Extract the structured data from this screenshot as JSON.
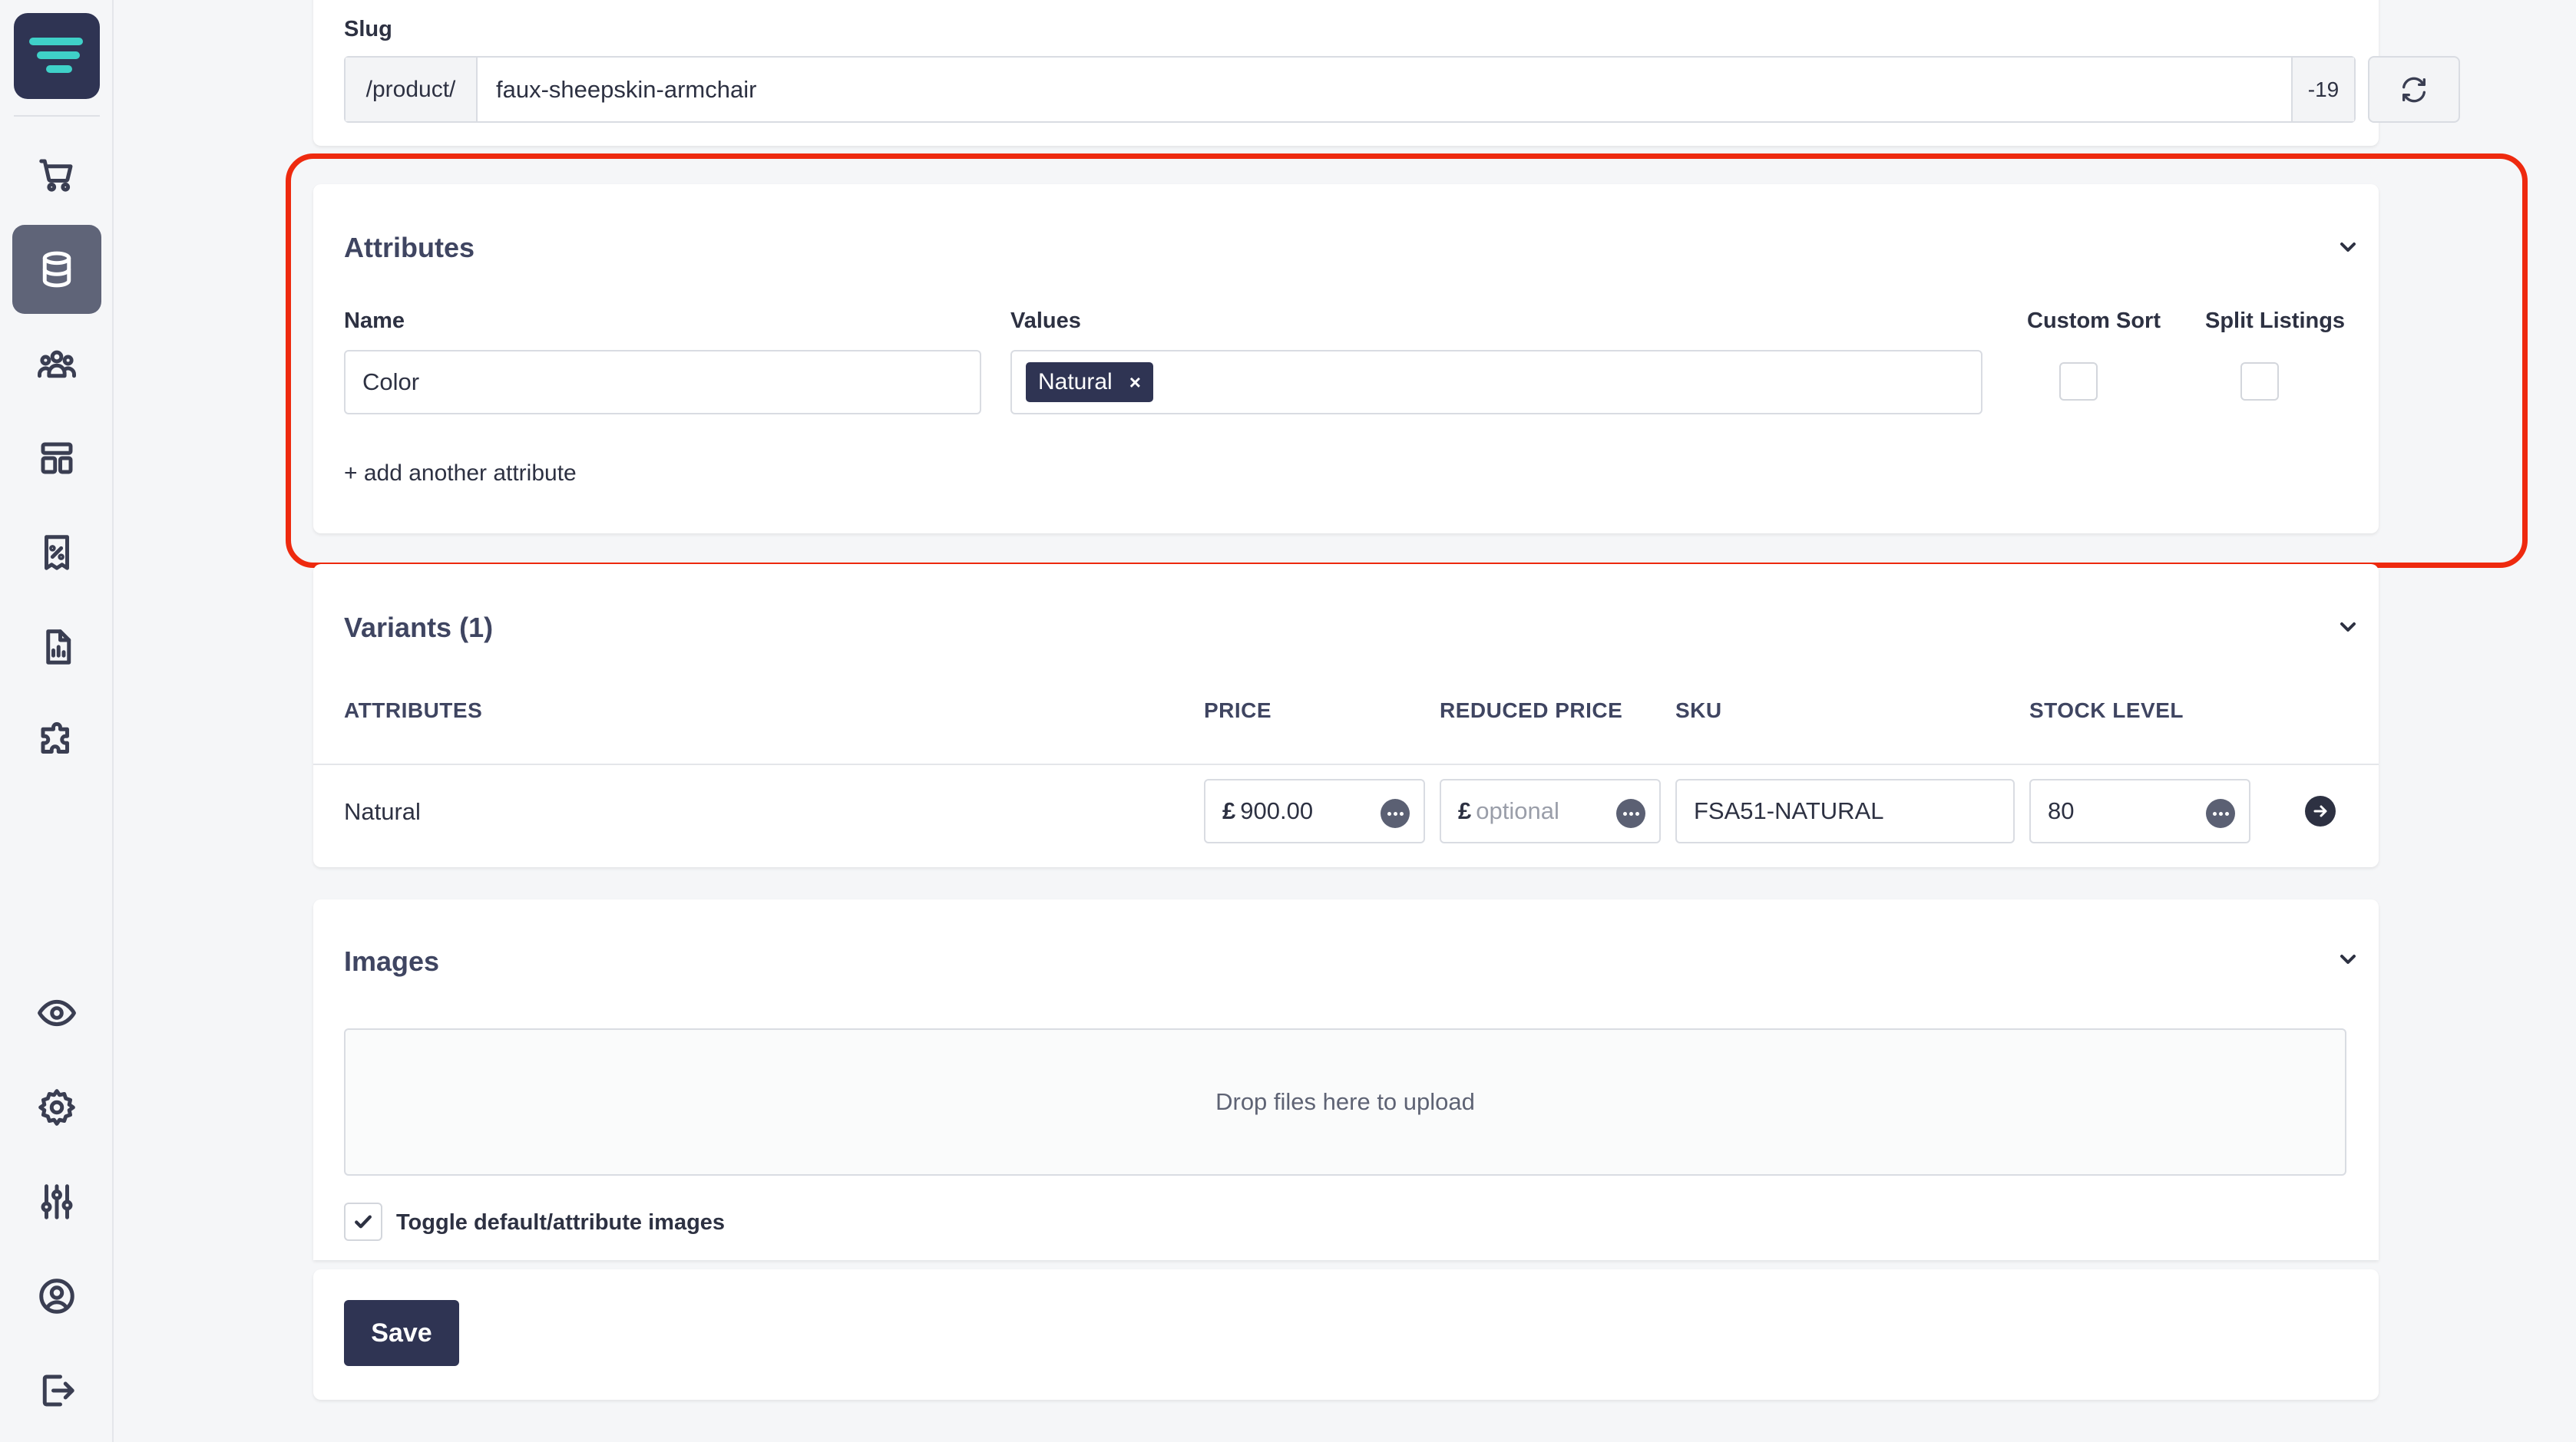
{
  "nav": {
    "items": [
      {
        "icon": "cart-icon"
      },
      {
        "icon": "database-icon",
        "active": true
      },
      {
        "icon": "users-icon"
      },
      {
        "icon": "layout-icon"
      },
      {
        "icon": "receipt-percent-icon"
      },
      {
        "icon": "report-icon"
      },
      {
        "icon": "puzzle-icon"
      },
      {
        "icon": "eye-icon"
      },
      {
        "icon": "gear-icon"
      },
      {
        "icon": "sliders-icon"
      },
      {
        "icon": "user-circle-icon"
      },
      {
        "icon": "logout-icon"
      }
    ]
  },
  "slug": {
    "label": "Slug",
    "prefix": "/product/",
    "value": "faux-sheepskin-armchair",
    "count": "-19"
  },
  "attributes": {
    "title": "Attributes",
    "name_label": "Name",
    "values_label": "Values",
    "custom_sort_label": "Custom Sort",
    "split_listings_label": "Split Listings",
    "name_value": "Color",
    "chip": "Natural",
    "chip_remove": "×",
    "add_link": "+ add another attribute"
  },
  "variants": {
    "title": "Variants (1)",
    "headers": {
      "attributes": "ATTRIBUTES",
      "price": "PRICE",
      "reduced": "REDUCED PRICE",
      "sku": "SKU",
      "stock": "STOCK LEVEL"
    },
    "row": {
      "attribute": "Natural",
      "currency": "£",
      "price": "900.00",
      "reduced_placeholder": "optional",
      "sku": "FSA51-NATURAL",
      "stock": "80"
    }
  },
  "images": {
    "title": "Images",
    "dropzone": "Drop files here to upload",
    "toggle_label": "Toggle default/attribute images",
    "toggle_checked": true
  },
  "footer": {
    "save_label": "Save"
  },
  "colors": {
    "accent": "#2f3453",
    "highlight": "#ee2a0f"
  }
}
